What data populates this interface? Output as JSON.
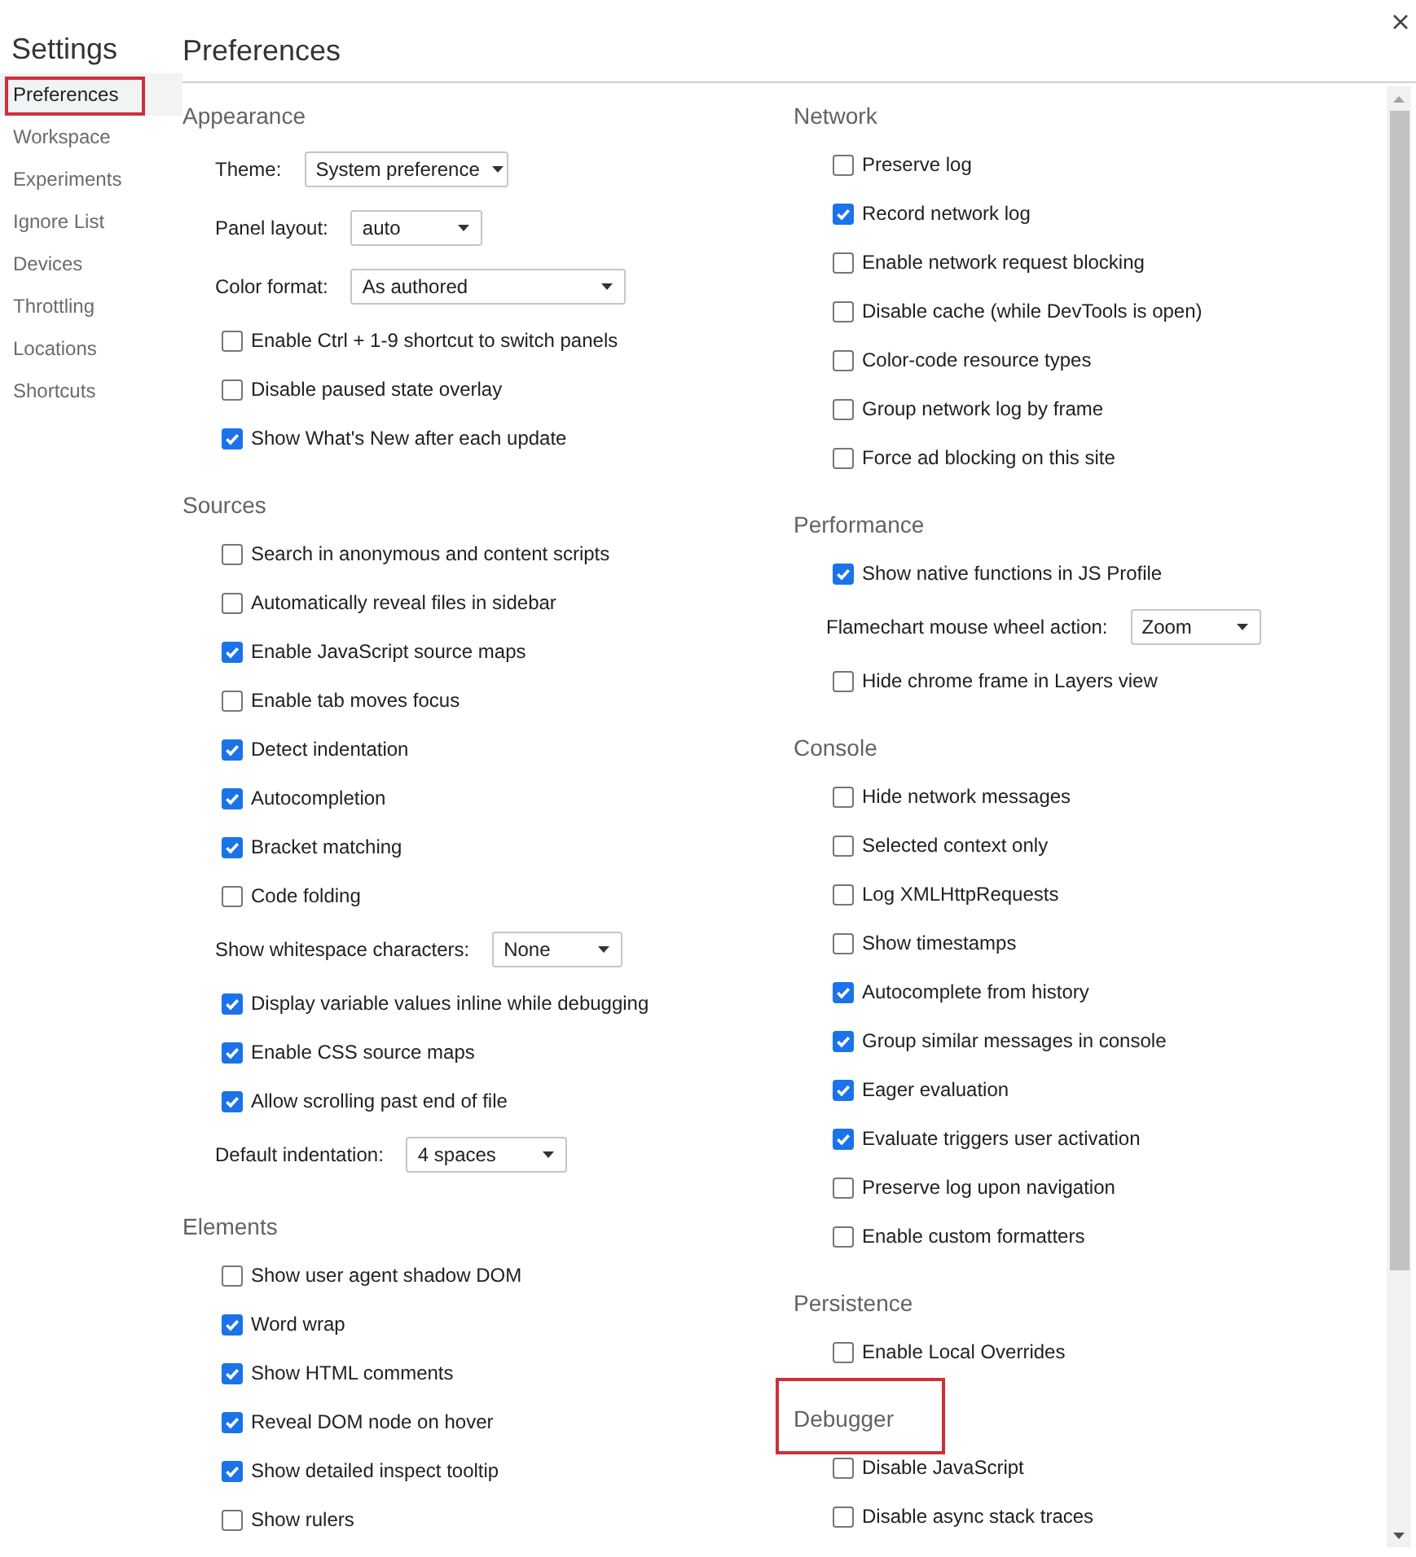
{
  "sidebar": {
    "title": "Settings",
    "items": [
      {
        "label": "Preferences",
        "selected": true,
        "highlighted": true
      },
      {
        "label": "Workspace",
        "selected": false,
        "highlighted": false
      },
      {
        "label": "Experiments",
        "selected": false,
        "highlighted": false
      },
      {
        "label": "Ignore List",
        "selected": false,
        "highlighted": false
      },
      {
        "label": "Devices",
        "selected": false,
        "highlighted": false
      },
      {
        "label": "Throttling",
        "selected": false,
        "highlighted": false
      },
      {
        "label": "Locations",
        "selected": false,
        "highlighted": false
      },
      {
        "label": "Shortcuts",
        "selected": false,
        "highlighted": false
      }
    ]
  },
  "header": {
    "title": "Preferences"
  },
  "columns": [
    {
      "sections": [
        {
          "title": "Appearance",
          "highlighted": false,
          "items": [
            {
              "kind": "select",
              "label": "Theme:",
              "value": "System preference"
            },
            {
              "kind": "select",
              "label": "Panel layout:",
              "value": "auto"
            },
            {
              "kind": "select",
              "label": "Color format:",
              "value": "As authored"
            },
            {
              "kind": "checkbox",
              "label": "Enable Ctrl + 1-9 shortcut to switch panels",
              "checked": false
            },
            {
              "kind": "checkbox",
              "label": "Disable paused state overlay",
              "checked": false
            },
            {
              "kind": "checkbox",
              "label": "Show What's New after each update",
              "checked": true
            }
          ]
        },
        {
          "title": "Sources",
          "highlighted": false,
          "items": [
            {
              "kind": "checkbox",
              "label": "Search in anonymous and content scripts",
              "checked": false
            },
            {
              "kind": "checkbox",
              "label": "Automatically reveal files in sidebar",
              "checked": false
            },
            {
              "kind": "checkbox",
              "label": "Enable JavaScript source maps",
              "checked": true
            },
            {
              "kind": "checkbox",
              "label": "Enable tab moves focus",
              "checked": false
            },
            {
              "kind": "checkbox",
              "label": "Detect indentation",
              "checked": true
            },
            {
              "kind": "checkbox",
              "label": "Autocompletion",
              "checked": true
            },
            {
              "kind": "checkbox",
              "label": "Bracket matching",
              "checked": true
            },
            {
              "kind": "checkbox",
              "label": "Code folding",
              "checked": false
            },
            {
              "kind": "select",
              "label": "Show whitespace characters:",
              "value": "None"
            },
            {
              "kind": "checkbox",
              "label": "Display variable values inline while debugging",
              "checked": true
            },
            {
              "kind": "checkbox",
              "label": "Enable CSS source maps",
              "checked": true
            },
            {
              "kind": "checkbox",
              "label": "Allow scrolling past end of file",
              "checked": true
            },
            {
              "kind": "select",
              "label": "Default indentation:",
              "value": "4 spaces"
            }
          ]
        },
        {
          "title": "Elements",
          "highlighted": false,
          "items": [
            {
              "kind": "checkbox",
              "label": "Show user agent shadow DOM",
              "checked": false
            },
            {
              "kind": "checkbox",
              "label": "Word wrap",
              "checked": true
            },
            {
              "kind": "checkbox",
              "label": "Show HTML comments",
              "checked": true
            },
            {
              "kind": "checkbox",
              "label": "Reveal DOM node on hover",
              "checked": true
            },
            {
              "kind": "checkbox",
              "label": "Show detailed inspect tooltip",
              "checked": true
            },
            {
              "kind": "checkbox",
              "label": "Show rulers",
              "checked": false
            }
          ]
        }
      ]
    },
    {
      "sections": [
        {
          "title": "Network",
          "highlighted": false,
          "items": [
            {
              "kind": "checkbox",
              "label": "Preserve log",
              "checked": false
            },
            {
              "kind": "checkbox",
              "label": "Record network log",
              "checked": true
            },
            {
              "kind": "checkbox",
              "label": "Enable network request blocking",
              "checked": false
            },
            {
              "kind": "checkbox",
              "label": "Disable cache (while DevTools is open)",
              "checked": false
            },
            {
              "kind": "checkbox",
              "label": "Color-code resource types",
              "checked": false
            },
            {
              "kind": "checkbox",
              "label": "Group network log by frame",
              "checked": false
            },
            {
              "kind": "checkbox",
              "label": "Force ad blocking on this site",
              "checked": false
            }
          ]
        },
        {
          "title": "Performance",
          "highlighted": false,
          "items": [
            {
              "kind": "checkbox",
              "label": "Show native functions in JS Profile",
              "checked": true
            },
            {
              "kind": "select",
              "label": "Flamechart mouse wheel action:",
              "value": "Zoom"
            },
            {
              "kind": "checkbox",
              "label": "Hide chrome frame in Layers view",
              "checked": false
            }
          ]
        },
        {
          "title": "Console",
          "highlighted": false,
          "items": [
            {
              "kind": "checkbox",
              "label": "Hide network messages",
              "checked": false
            },
            {
              "kind": "checkbox",
              "label": "Selected context only",
              "checked": false
            },
            {
              "kind": "checkbox",
              "label": "Log XMLHttpRequests",
              "checked": false
            },
            {
              "kind": "checkbox",
              "label": "Show timestamps",
              "checked": false
            },
            {
              "kind": "checkbox",
              "label": "Autocomplete from history",
              "checked": true
            },
            {
              "kind": "checkbox",
              "label": "Group similar messages in console",
              "checked": true
            },
            {
              "kind": "checkbox",
              "label": "Eager evaluation",
              "checked": true
            },
            {
              "kind": "checkbox",
              "label": "Evaluate triggers user activation",
              "checked": true
            },
            {
              "kind": "checkbox",
              "label": "Preserve log upon navigation",
              "checked": false
            },
            {
              "kind": "checkbox",
              "label": "Enable custom formatters",
              "checked": false
            }
          ]
        },
        {
          "title": "Persistence",
          "highlighted": false,
          "items": [
            {
              "kind": "checkbox",
              "label": "Enable Local Overrides",
              "checked": false
            }
          ]
        },
        {
          "title": "Debugger",
          "highlighted": true,
          "items": [
            {
              "kind": "checkbox",
              "label": "Disable JavaScript",
              "checked": false
            },
            {
              "kind": "checkbox",
              "label": "Disable async stack traces",
              "checked": false
            }
          ]
        }
      ]
    }
  ]
}
